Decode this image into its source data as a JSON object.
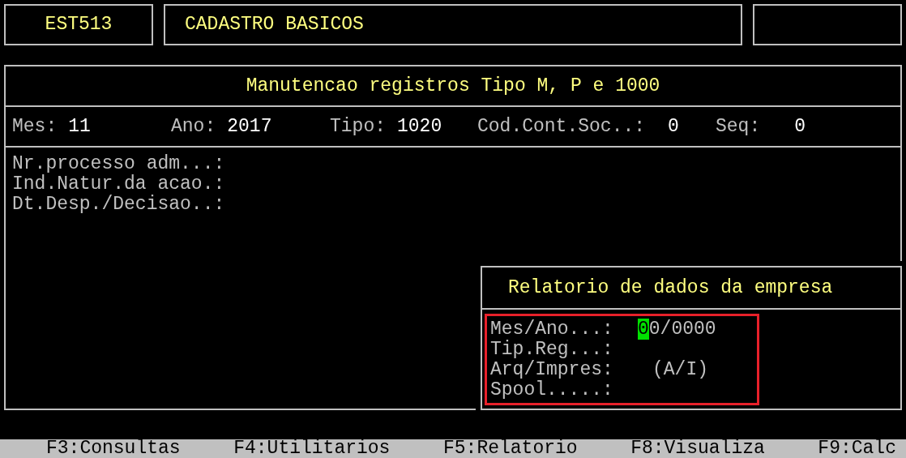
{
  "header": {
    "program_code": "EST513",
    "title": "CADASTRO BASICOS"
  },
  "panel": {
    "title": "Manutencao registros Tipo M, P e 1000",
    "key_fields": [
      {
        "label": "Mes:",
        "value": "11"
      },
      {
        "label": "Ano:",
        "value": "2017"
      },
      {
        "label": "Tipo:",
        "value": "1020"
      },
      {
        "label": "Cod.Cont.Soc..:",
        "value": "0"
      },
      {
        "label": "Seq:",
        "value": "0"
      }
    ],
    "fields": [
      {
        "label": "Nr.processo adm...:"
      },
      {
        "label": "Ind.Natur.da acao.:"
      },
      {
        "label": "Dt.Desp./Decisao..:"
      }
    ]
  },
  "dialog": {
    "title": "Relatorio de dados da empresa",
    "fields": [
      {
        "label": "Mes/Ano...:",
        "value": "00/0000",
        "cursor": true
      },
      {
        "label": "Tip.Reg...:"
      },
      {
        "label": "Arq/Impres:",
        "hint": "(A/I)"
      },
      {
        "label": "Spool.....:"
      }
    ]
  },
  "function_keys": [
    "F3:Consultas",
    "F4:Utilitarios",
    "F5:Relatorio",
    "F8:Visualiza",
    "F9:Calc"
  ]
}
